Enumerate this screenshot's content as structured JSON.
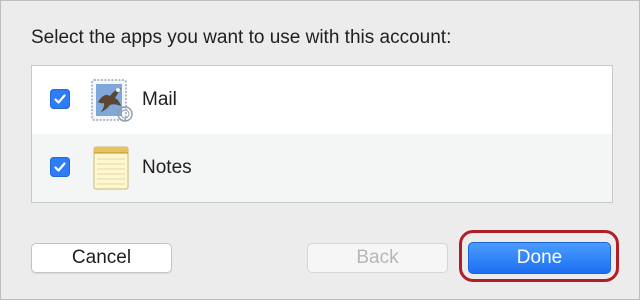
{
  "dialog": {
    "prompt": "Select the apps you want to use with this account:"
  },
  "apps": [
    {
      "label": "Mail",
      "checked": true,
      "icon": "mail-icon"
    },
    {
      "label": "Notes",
      "checked": true,
      "icon": "notes-icon"
    }
  ],
  "buttons": {
    "cancel": "Cancel",
    "back": "Back",
    "done": "Done"
  },
  "colors": {
    "accent": "#2e7cf6",
    "highlight": "#b01f25",
    "disabled_text": "#b7b7b7"
  }
}
